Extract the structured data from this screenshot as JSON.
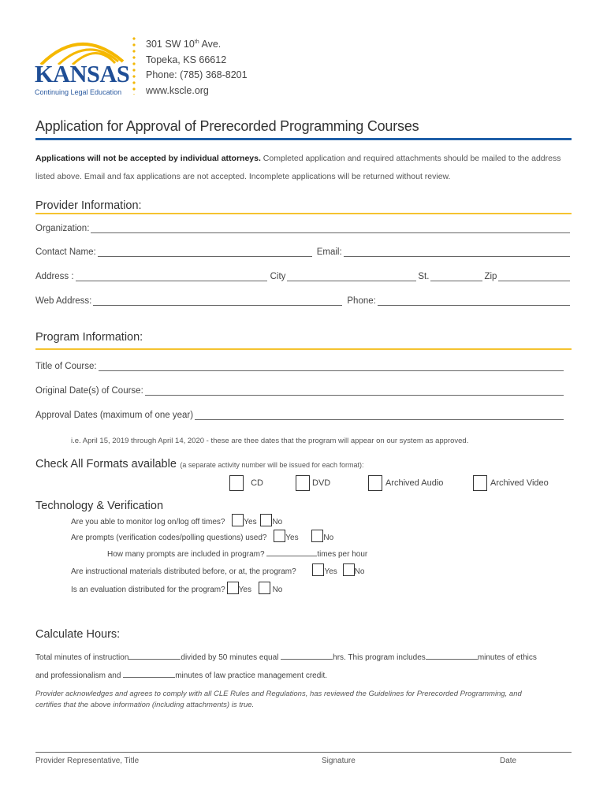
{
  "header": {
    "logo": {
      "name": "KANSAS",
      "subtitle": "Continuing Legal Education"
    },
    "address_line1_pre": "301 SW 10",
    "address_line1_sup": "th",
    "address_line1_post": " Ave.",
    "address_line2": "Topeka, KS 66612",
    "phone": "Phone: (785) 368-8201",
    "website": "www.kscle.org"
  },
  "colors": {
    "brand_blue": "#1f5fa8",
    "brand_yellow": "#f5c330"
  },
  "title": "Application for Approval of Prerecorded Programming Courses",
  "intro": {
    "bold": "Applications will not be accepted by individual attorneys.",
    "text": " Completed application and required attachments should be mailed to the address listed above. Email and fax applications are not accepted. Incomplete applications will be returned without review."
  },
  "provider": {
    "heading": "Provider Information:",
    "organization_label": "Organization:",
    "organization_value": "",
    "contact_label": "Contact Name:",
    "contact_value": "",
    "email_label": "Email:",
    "email_value": "",
    "address_label": "Address :",
    "address_value": "",
    "city_label": "City",
    "city_value": "",
    "state_label": "St.",
    "state_value": "",
    "zip_label": "Zip",
    "zip_value": "",
    "web_label": "Web Address:",
    "web_value": "",
    "phone_label": "Phone:",
    "phone_value": ""
  },
  "program": {
    "heading": "Program Information:",
    "title_label": "Title of Course:",
    "title_value": "",
    "original_label": "Original Date(s) of Course:",
    "original_value": "",
    "approval_label": "Approval Dates (maximum of one year)",
    "approval_value": "",
    "approval_note": "i.e. April 15, 2019 through April 14, 2020 - these are thee dates that the program will appear on our system as approved."
  },
  "formats": {
    "heading": "Check All Formats available",
    "note": "(a separate activity number will be issued for each format):",
    "options": [
      {
        "label": "CD",
        "checked": false
      },
      {
        "label": "DVD",
        "checked": false
      },
      {
        "label": "Archived Audio",
        "checked": false
      },
      {
        "label": "Archived Video",
        "checked": false
      }
    ]
  },
  "technology": {
    "heading": "Technology & Verification",
    "q1": "Are you able to monitor log on/log off times?",
    "q2": "Are prompts (verification codes/polling questions) used?",
    "q2_sub_label": "How many prompts are included in program?",
    "q2_sub_suffix": "times per hour",
    "q3": "Are instructional materials distributed before, or at, the program?",
    "q4": "Is an evaluation distributed for the program?",
    "yes": "Yes",
    "no": "No"
  },
  "hours": {
    "heading": "Calculate Hours:",
    "t1": "Total minutes of instruction",
    "t2": "divided by 50 minutes equal",
    "t3": "hrs. This program includes",
    "t4": "minutes of ethics",
    "t5": "and professionalism and",
    "t6": "minutes of law practice management credit.",
    "ack": "Provider acknowledges and agrees to comply with all CLE Rules and Regulations, has reviewed the Guidelines for Prerecorded Programming, and certifies that the above information (including attachments) is true."
  },
  "signature": {
    "rep_label": "Provider Representative, Title",
    "sig_label": "Signature",
    "date_label": "Date"
  }
}
